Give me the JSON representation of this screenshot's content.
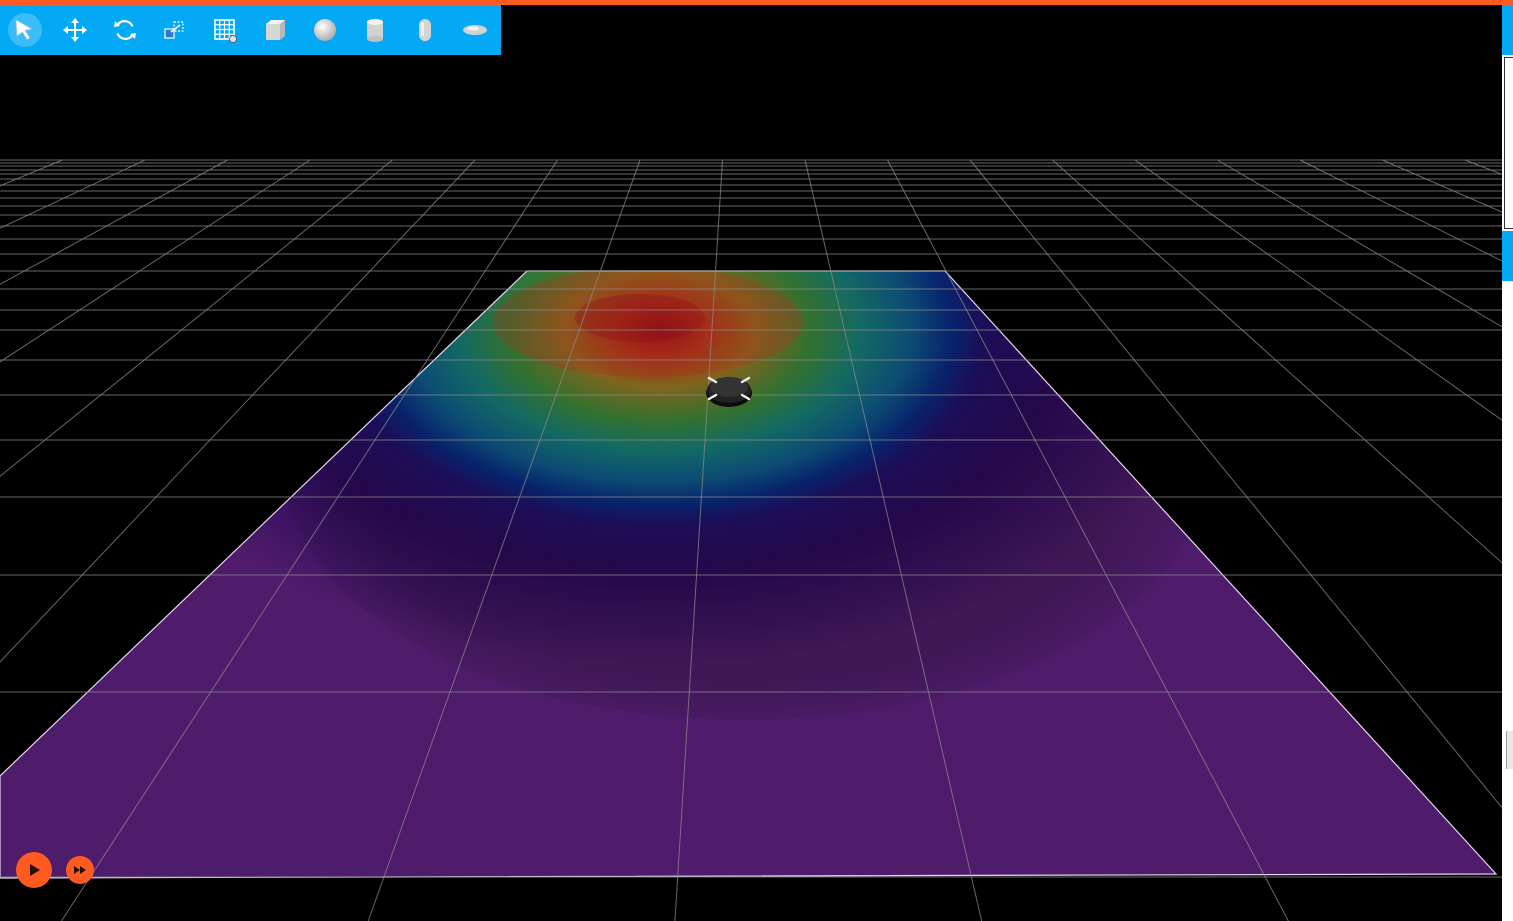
{
  "colors": {
    "accent": "#ff5a1f",
    "toolbar_bg": "#03a9f4",
    "viewport_bg": "#000000",
    "grid_line": "#8a8a8a",
    "heatmap_low": "#4e1c6a",
    "heatmap_mid": "#0f6f88",
    "heatmap_high": "#b0151c",
    "robot": "#1c1c1c"
  },
  "toolbar": {
    "tools": [
      {
        "id": "select",
        "icon": "pointer-arrow-icon",
        "active": true
      },
      {
        "id": "translate",
        "icon": "move-arrows-icon",
        "active": false
      },
      {
        "id": "rotate",
        "icon": "rotate-icon",
        "active": false
      },
      {
        "id": "scale",
        "icon": "scale-box-icon",
        "active": false
      },
      {
        "id": "grid",
        "icon": "grid-icon",
        "active": false
      },
      {
        "id": "box",
        "icon": "box-shape-icon",
        "active": false
      },
      {
        "id": "sphere",
        "icon": "sphere-shape-icon",
        "active": false
      },
      {
        "id": "cylinder",
        "icon": "cylinder-shape-icon",
        "active": false
      },
      {
        "id": "capsule",
        "icon": "capsule-shape-icon",
        "active": false
      },
      {
        "id": "ellipsoid",
        "icon": "ellipsoid-shape-icon",
        "active": false
      }
    ]
  },
  "playback": {
    "play_icon": "play-icon",
    "fast_forward_icon": "fast-forward-icon"
  }
}
